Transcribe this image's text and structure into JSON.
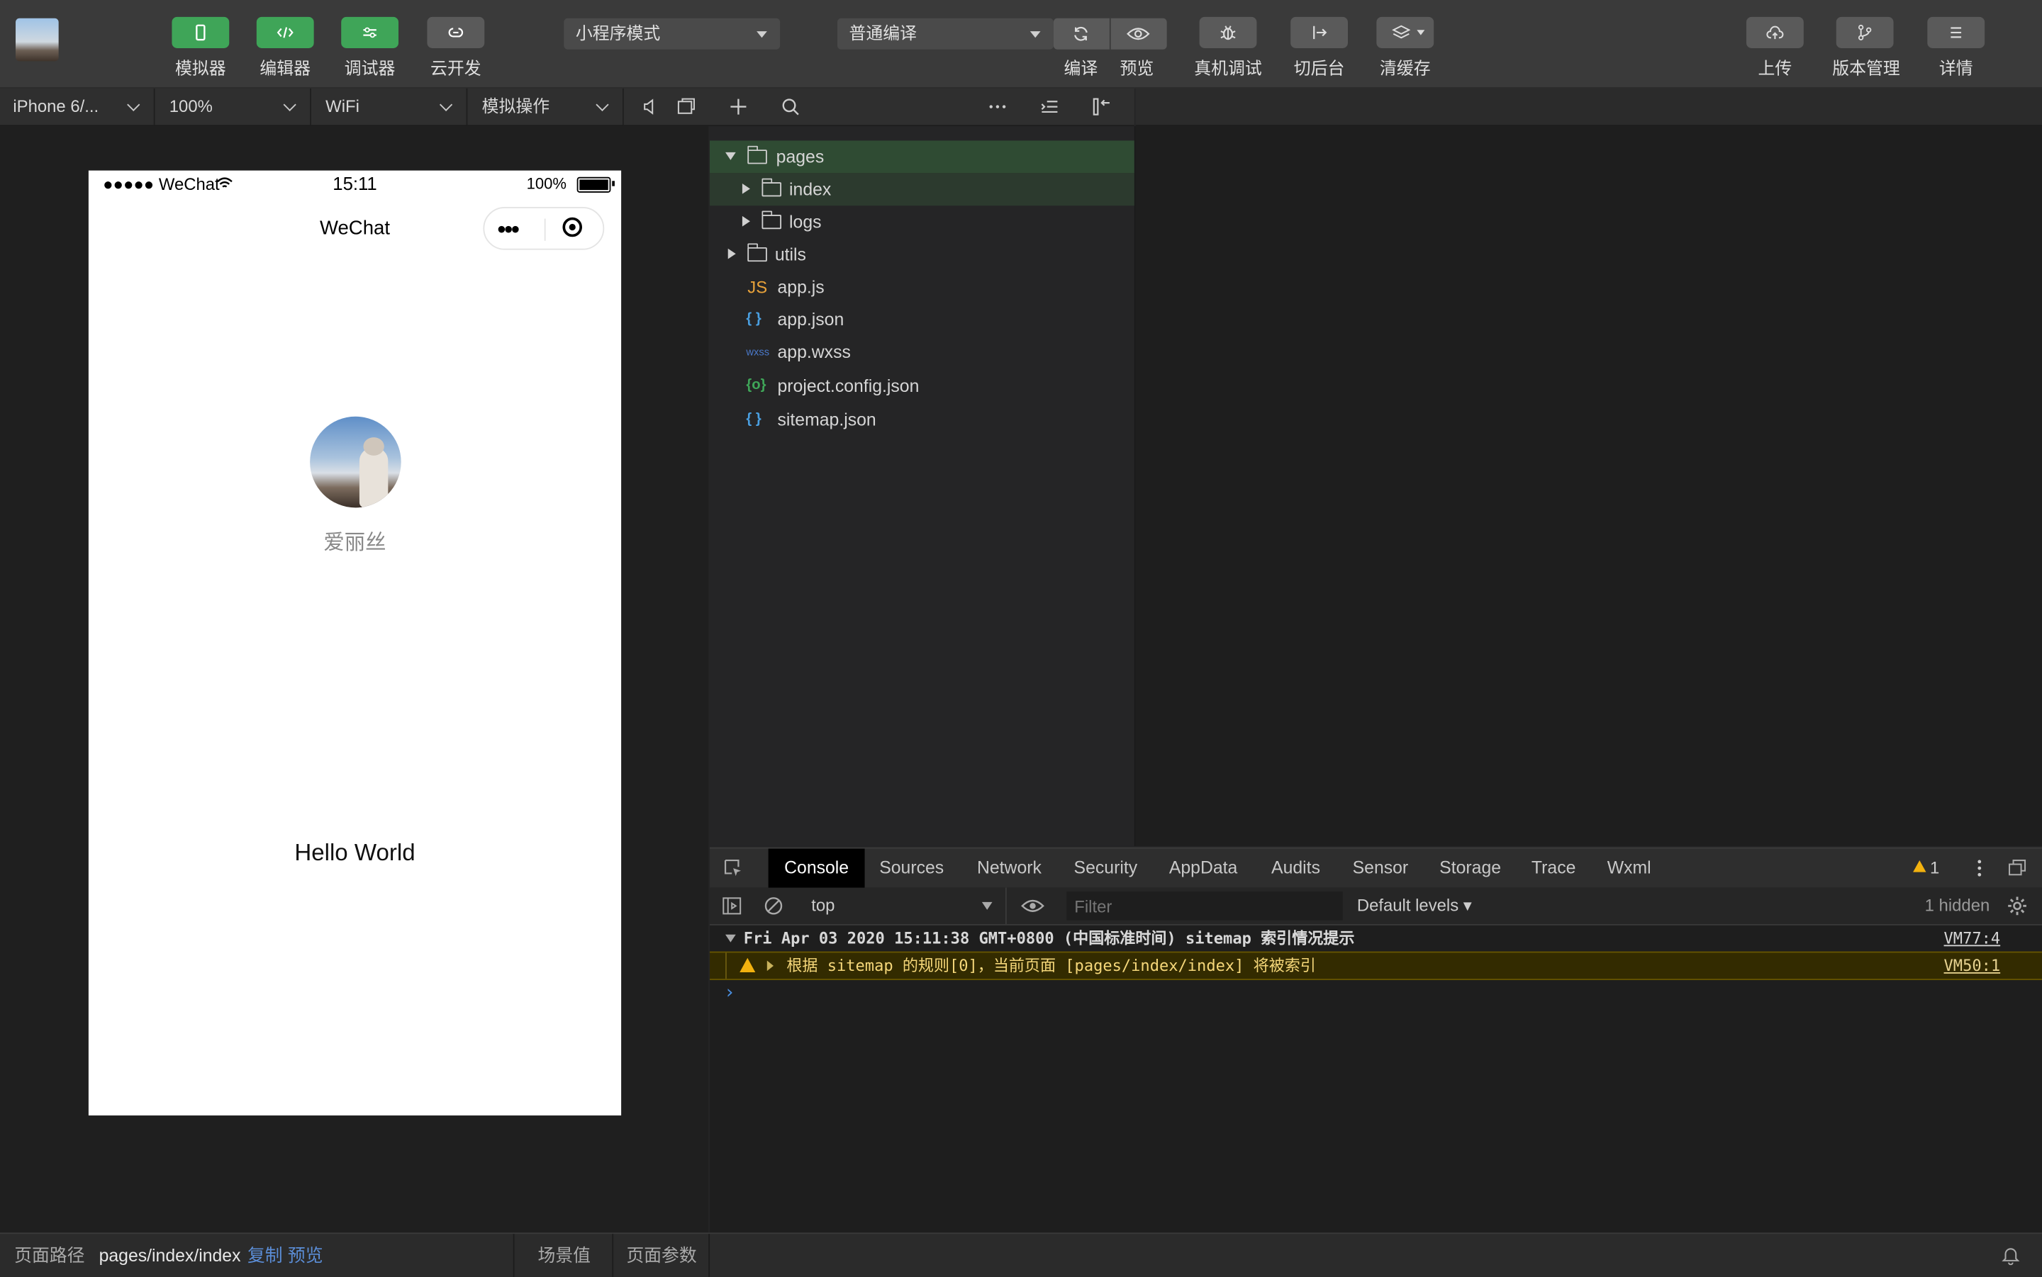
{
  "toolbar": {
    "buttons": [
      {
        "label": "模拟器"
      },
      {
        "label": "编辑器"
      },
      {
        "label": "调试器"
      },
      {
        "label": "云开发"
      }
    ],
    "mode_select": "小程序模式",
    "compile_select": "普通编译",
    "compile_label": "编译",
    "preview_label": "预览",
    "remote_debug_label": "真机调试",
    "background_label": "切后台",
    "clear_cache_label": "清缓存",
    "upload_label": "上传",
    "version_label": "版本管理",
    "details_label": "详情"
  },
  "simulator_bar": {
    "device": "iPhone 6/...",
    "zoom": "100%",
    "network": "WiFi",
    "operation": "模拟操作"
  },
  "phone": {
    "carrier": "●●●●● WeChat",
    "time": "15:11",
    "battery": "100%",
    "nav_title": "WeChat",
    "user_name": "爱丽丝",
    "hello_text": "Hello World"
  },
  "explorer": {
    "items": [
      {
        "name": "pages"
      },
      {
        "name": "index"
      },
      {
        "name": "logs"
      },
      {
        "name": "utils"
      },
      {
        "name": "app.js",
        "icon": "JS"
      },
      {
        "name": "app.json",
        "icon": "{ }"
      },
      {
        "name": "app.wxss",
        "icon": "wxss"
      },
      {
        "name": "project.config.json",
        "icon": "{o}"
      },
      {
        "name": "sitemap.json",
        "icon": "{ }"
      }
    ]
  },
  "devtools": {
    "tabs": [
      "Console",
      "Sources",
      "Network",
      "Security",
      "AppData",
      "Audits",
      "Sensor",
      "Storage",
      "Trace",
      "Wxml"
    ],
    "warning_count": "1",
    "context": "top",
    "filter_placeholder": "Filter",
    "levels": "Default levels ▾",
    "hidden_count": "1 hidden",
    "logs": [
      {
        "text": "Fri Apr 03 2020 15:11:38 GMT+0800 (中国标准时间) sitemap 索引情况提示",
        "source": "VM77:4"
      },
      {
        "text": "根据 sitemap 的规则[0]，当前页面 [pages/index/index] 将被索引",
        "source": "VM50:1"
      }
    ],
    "prompt": "›"
  },
  "bottombar": {
    "path_label": "页面路径",
    "path_value": "pages/index/index",
    "copy": "复制",
    "preview": "预览",
    "scene": "场景值",
    "params": "页面参数"
  },
  "colors": {
    "green": "#3fa558",
    "accent_link": "#5b8dd6",
    "warning": "#f3b20f"
  }
}
